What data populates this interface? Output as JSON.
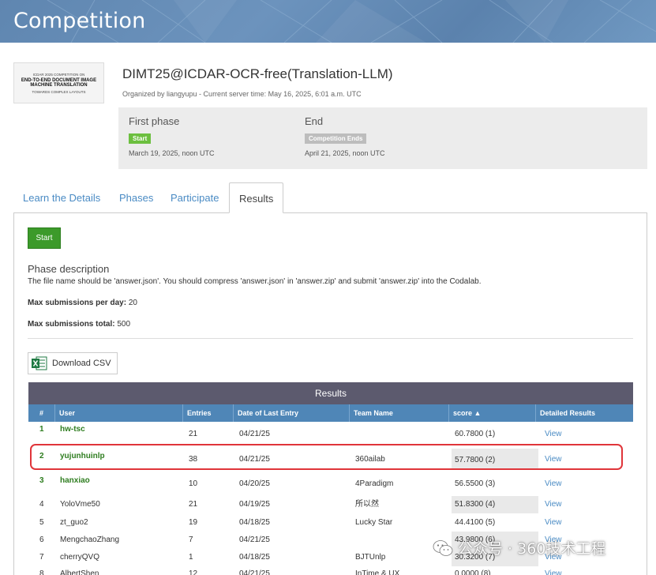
{
  "banner": {
    "title": "Competition"
  },
  "competition": {
    "logo_lines": [
      "ICDAR 2025 COMPETITION ON",
      "END-TO-END DOCUMENT IMAGE",
      "MACHINE TRANSLATION",
      "TOWARDS COMPLEX LAYOUTS"
    ],
    "name": "DIMT25@ICDAR-OCR-free(Translation-LLM)",
    "meta": "Organized by liangyupu - Current server time: May 16, 2025, 6:01 a.m. UTC"
  },
  "phases": [
    {
      "title": "First phase",
      "badge": "Start",
      "badge_color": "#6cbf3f",
      "date": "March 19, 2025, noon UTC"
    },
    {
      "title": "End",
      "badge": "Competition Ends",
      "badge_color": "#bdbdbd",
      "date": "April 21, 2025, noon UTC"
    }
  ],
  "tabs": [
    {
      "label": "Learn the Details",
      "active": false
    },
    {
      "label": "Phases",
      "active": false
    },
    {
      "label": "Participate",
      "active": false
    },
    {
      "label": "Results",
      "active": true
    }
  ],
  "results_panel": {
    "start_button": "Start",
    "phase_description_heading": "Phase description",
    "phase_description_text": "The file name should be 'answer.json'. You should compress 'answer.json' in 'answer.zip' and submit 'answer.zip' into the Codalab.",
    "max_per_day_label": "Max submissions per day:",
    "max_per_day_value": "20",
    "max_total_label": "Max submissions total:",
    "max_total_value": "500",
    "download_csv": "Download CSV"
  },
  "table": {
    "title": "Results",
    "columns": [
      "#",
      "User",
      "Entries",
      "Date of Last Entry",
      "Team Name",
      "score ▲",
      "Detailed Results"
    ],
    "rows": [
      {
        "rank": "1",
        "user": "hw-tsc",
        "entries": "21",
        "date": "04/21/25",
        "team": "",
        "score": "60.7800 (1)",
        "view": "View"
      },
      {
        "rank": "2",
        "user": "yujunhuinlp",
        "entries": "38",
        "date": "04/21/25",
        "team": "360ailab",
        "score": "57.7800 (2)",
        "view": "View"
      },
      {
        "rank": "3",
        "user": "hanxiao",
        "entries": "10",
        "date": "04/20/25",
        "team": "4Paradigm",
        "score": "56.5500 (3)",
        "view": "View"
      },
      {
        "rank": "4",
        "user": "YoloVme50",
        "entries": "21",
        "date": "04/19/25",
        "team": "所以然",
        "score": "51.8300 (4)",
        "view": "View"
      },
      {
        "rank": "5",
        "user": "zt_guo2",
        "entries": "19",
        "date": "04/18/25",
        "team": "Lucky Star",
        "score": "44.4100 (5)",
        "view": "View"
      },
      {
        "rank": "6",
        "user": "MengchaoZhang",
        "entries": "7",
        "date": "04/21/25",
        "team": "",
        "score": "43.9800 (6)",
        "view": "View"
      },
      {
        "rank": "7",
        "user": "cherryQVQ",
        "entries": "1",
        "date": "04/18/25",
        "team": "BJTUnlp",
        "score": "30.3200 (7)",
        "view": "View"
      },
      {
        "rank": "8",
        "user": "AlbertShen",
        "entries": "12",
        "date": "04/21/25",
        "team": "InTime & UX",
        "score": "0.0000 (8)",
        "view": "View"
      }
    ]
  },
  "watermark": "公众号 · 360技术工程"
}
